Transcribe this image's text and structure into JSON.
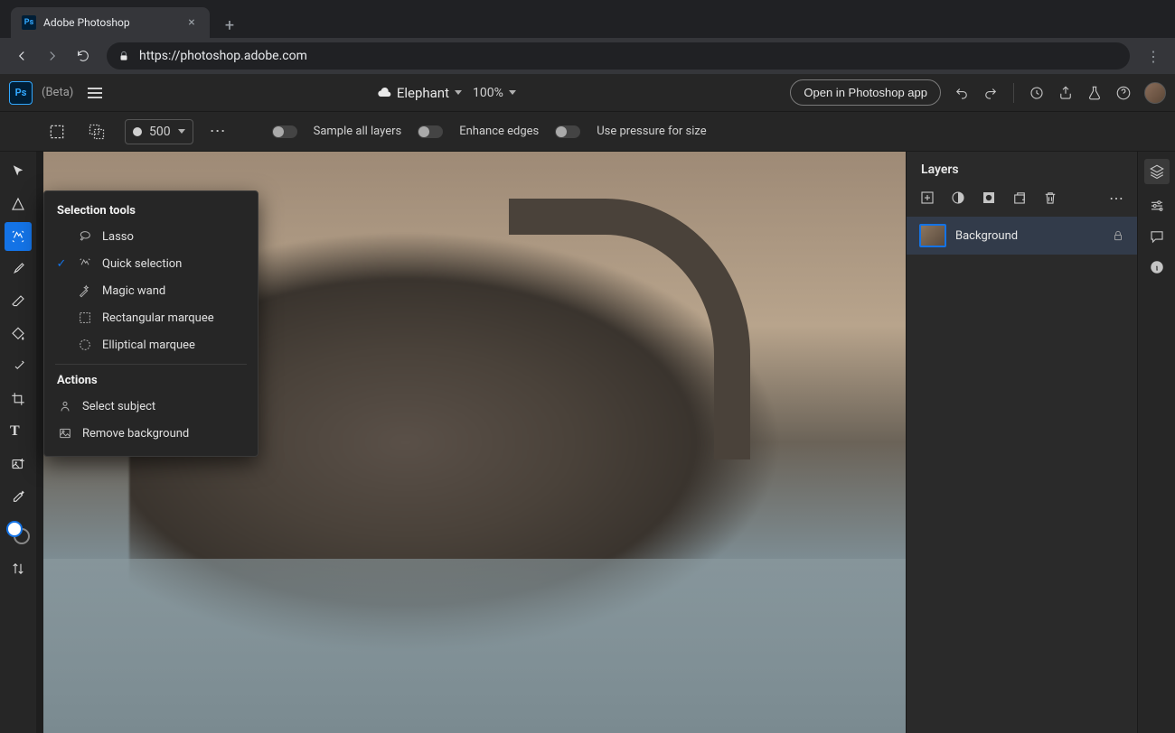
{
  "browser": {
    "tab_title": "Adobe Photoshop",
    "url": "https://photoshop.adobe.com"
  },
  "header": {
    "logo": "Ps",
    "beta": "(Beta)",
    "doc_name": "Elephant",
    "zoom": "100%",
    "open_in_app": "Open in Photoshop app"
  },
  "options": {
    "size": "500",
    "sample_all": "Sample all layers",
    "enhance": "Enhance edges",
    "pressure": "Use pressure for size"
  },
  "flyout": {
    "header_selection": "Selection tools",
    "lasso": "Lasso",
    "quick": "Quick selection",
    "wand": "Magic wand",
    "rect": "Rectangular marquee",
    "ellipse": "Elliptical marquee",
    "header_actions": "Actions",
    "select_subject": "Select subject",
    "remove_bg": "Remove background"
  },
  "layers": {
    "panel_title": "Layers",
    "bg_layer": "Background"
  }
}
